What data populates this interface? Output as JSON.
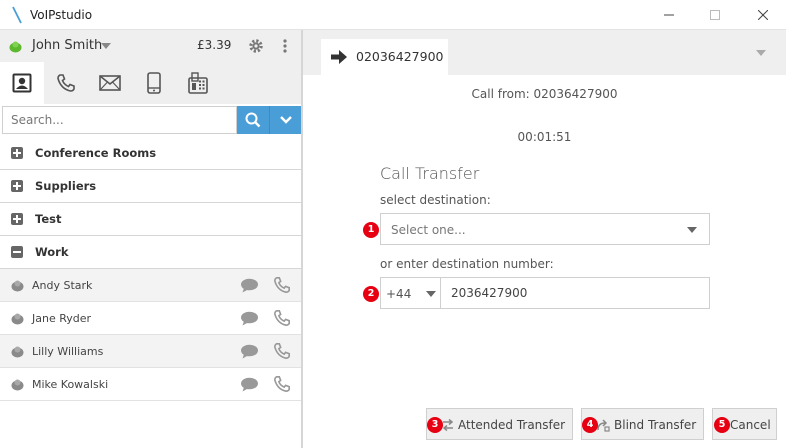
{
  "window": {
    "title": "VoIPstudio"
  },
  "user": {
    "name": "John Smith",
    "balance": "£3.39"
  },
  "search": {
    "placeholder": "Search..."
  },
  "groups": [
    {
      "label": "Conference Rooms",
      "expanded": false
    },
    {
      "label": "Suppliers",
      "expanded": false
    },
    {
      "label": "Test",
      "expanded": false
    },
    {
      "label": "Work",
      "expanded": true
    }
  ],
  "contacts": [
    {
      "name": "Andy Stark"
    },
    {
      "name": "Jane Ryder"
    },
    {
      "name": "Lilly Williams"
    },
    {
      "name": "Mike Kowalski"
    }
  ],
  "call": {
    "tab_number": "02036427900",
    "call_from": "Call from: 02036427900",
    "timer": "00:01:51"
  },
  "transfer": {
    "title": "Call Transfer",
    "select_label": "select destination:",
    "select_placeholder": "Select one...",
    "number_label": "or enter destination number:",
    "prefix": "+44",
    "number_value": "2036427900"
  },
  "buttons": {
    "attended": "Attended Transfer",
    "blind": "Blind Transfer",
    "cancel": "Cancel"
  },
  "badges": [
    "1",
    "2",
    "3",
    "4",
    "5"
  ],
  "colors": {
    "accent": "#4a9ed8",
    "badge": "#e60012",
    "online": "#5cb82e",
    "offline": "#8a8a8a"
  }
}
